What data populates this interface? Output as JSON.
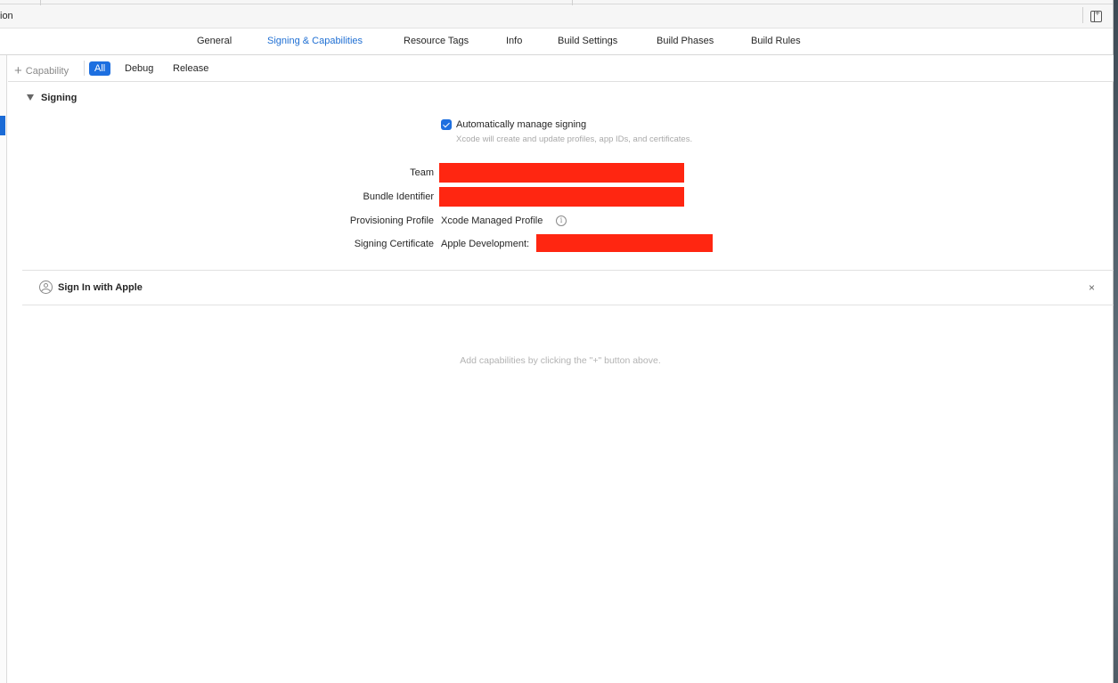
{
  "titlebar": {
    "crumb": "ion"
  },
  "tabs": [
    {
      "label": "General",
      "active": false
    },
    {
      "label": "Signing & Capabilities",
      "active": true
    },
    {
      "label": "Resource Tags",
      "active": false
    },
    {
      "label": "Info",
      "active": false
    },
    {
      "label": "Build Settings",
      "active": false
    },
    {
      "label": "Build Phases",
      "active": false
    },
    {
      "label": "Build Rules",
      "active": false
    }
  ],
  "capbar": {
    "add_label": "Capability",
    "filters": [
      {
        "label": "All",
        "active": true
      },
      {
        "label": "Debug",
        "active": false
      },
      {
        "label": "Release",
        "active": false
      }
    ]
  },
  "signing": {
    "header": "Signing",
    "auto_manage": {
      "checked": true,
      "label": "Automatically manage signing",
      "description": "Xcode will create and update profiles, app IDs, and certificates."
    },
    "team_label": "Team",
    "bundle_label": "Bundle Identifier",
    "profile_label": "Provisioning Profile",
    "profile_value": "Xcode Managed Profile",
    "cert_label": "Signing Certificate",
    "cert_value": "Apple Development:",
    "info_icon": "info-icon",
    "redaction_color": "#ff2611"
  },
  "sign_in_with_apple": {
    "title": "Sign In with Apple",
    "remove_glyph": "×"
  },
  "hint": "Add capabilities by clicking the \"+\" button above.",
  "accent_color": "#1d6fe0"
}
